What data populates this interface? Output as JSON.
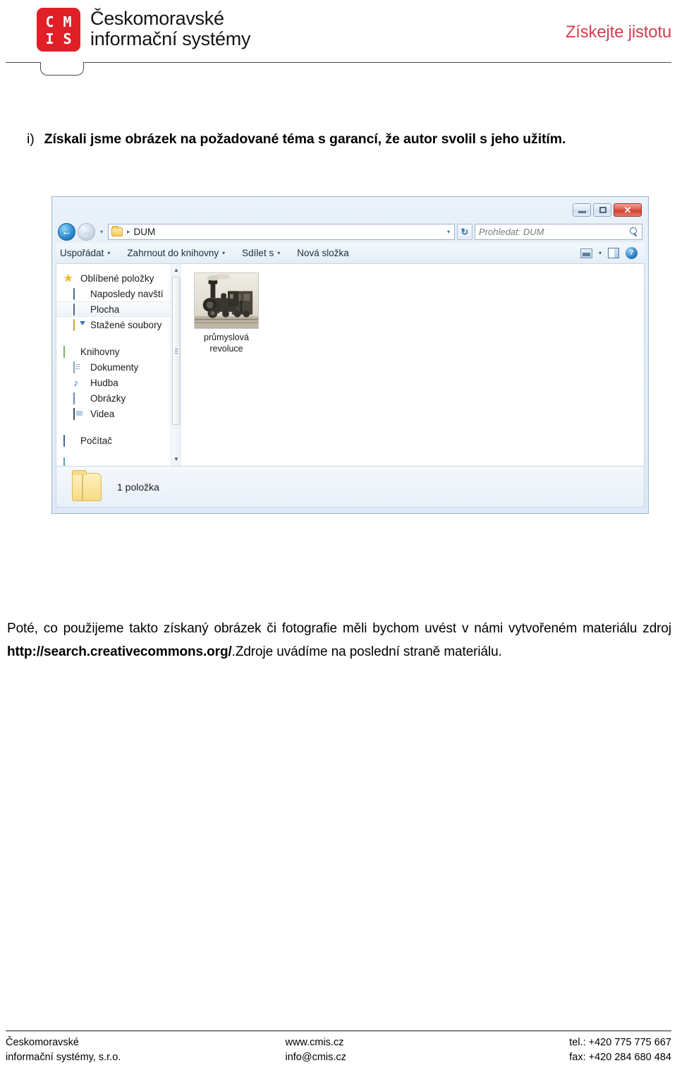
{
  "header": {
    "logo": {
      "mark_top": [
        "C",
        "M"
      ],
      "mark_bottom": [
        "I",
        "S"
      ],
      "line1": "Českomoravské",
      "line2": "informační systémy",
      "color": "#e01f26"
    },
    "tagline": "Získejte jistotu",
    "tagline_color": "#cf4050"
  },
  "intro": {
    "marker": "i)",
    "text": "Získali jsme obrázek na požadované téma s garancí, že autor svolil s jeho užitím."
  },
  "explorer": {
    "window_buttons": {
      "minimize": "—",
      "maximize": "□",
      "close": "✕"
    },
    "address": {
      "back_arrow": "←",
      "forward_arrow": "→",
      "dropdown": "▾",
      "separator": "▸",
      "path": "DUM",
      "caret": "▾",
      "refresh": "↻"
    },
    "search": {
      "placeholder": "Prohledat: DUM"
    },
    "toolbar": {
      "items": [
        {
          "label": "Uspořádat",
          "caret": "▾"
        },
        {
          "label": "Zahrnout do knihovny",
          "caret": "▾"
        },
        {
          "label": "Sdílet s",
          "caret": "▾"
        },
        {
          "label": "Nová složka",
          "caret": ""
        }
      ],
      "view_caret": "▾",
      "help_glyph": "?"
    },
    "nav_pane": {
      "groups": [
        {
          "header": {
            "label": "Oblíbené položky",
            "icon": "star-icon"
          },
          "items": [
            {
              "label": "Naposledy navští",
              "icon": "recent-places-icon",
              "selected": false
            },
            {
              "label": "Plocha",
              "icon": "desktop-icon",
              "selected": true
            },
            {
              "label": "Stažené soubory",
              "icon": "downloads-icon",
              "selected": false
            }
          ]
        },
        {
          "header": {
            "label": "Knihovny",
            "icon": "libraries-icon"
          },
          "items": [
            {
              "label": "Dokumenty",
              "icon": "documents-icon",
              "selected": false
            },
            {
              "label": "Hudba",
              "icon": "music-icon",
              "selected": false
            },
            {
              "label": "Obrázky",
              "icon": "pictures-icon",
              "selected": false
            },
            {
              "label": "Videa",
              "icon": "videos-icon",
              "selected": false
            }
          ]
        },
        {
          "header": {
            "label": "Počítač",
            "icon": "computer-icon"
          },
          "items": []
        }
      ],
      "scroll_up": "▲",
      "scroll_down": "▼"
    },
    "content": {
      "files": [
        {
          "label_line1": "průmyslová",
          "label_line2": "revoluce",
          "thumbnail": "steam-locomotive-photo"
        }
      ]
    },
    "status": {
      "text": "1 položka",
      "icon": "folder-icon"
    }
  },
  "body_paragraph": {
    "part1": "Poté, co použijeme takto získaný obrázek či fotografie měli bychom uvést v námi vytvořeném materiálu zdroj ",
    "link": "http://search.creativecommons.org/",
    "part2": ".Zdroje uvádíme na poslední straně materiálu."
  },
  "footer": {
    "left_line1": "Českomoravské",
    "left_line2": "informační systémy, s.r.o.",
    "mid_line1": "www.cmis.cz",
    "mid_line2": "info@cmis.cz",
    "right_line1": "tel.: +420 775 775 667",
    "right_line2": "fax: +420 284 680 484"
  }
}
